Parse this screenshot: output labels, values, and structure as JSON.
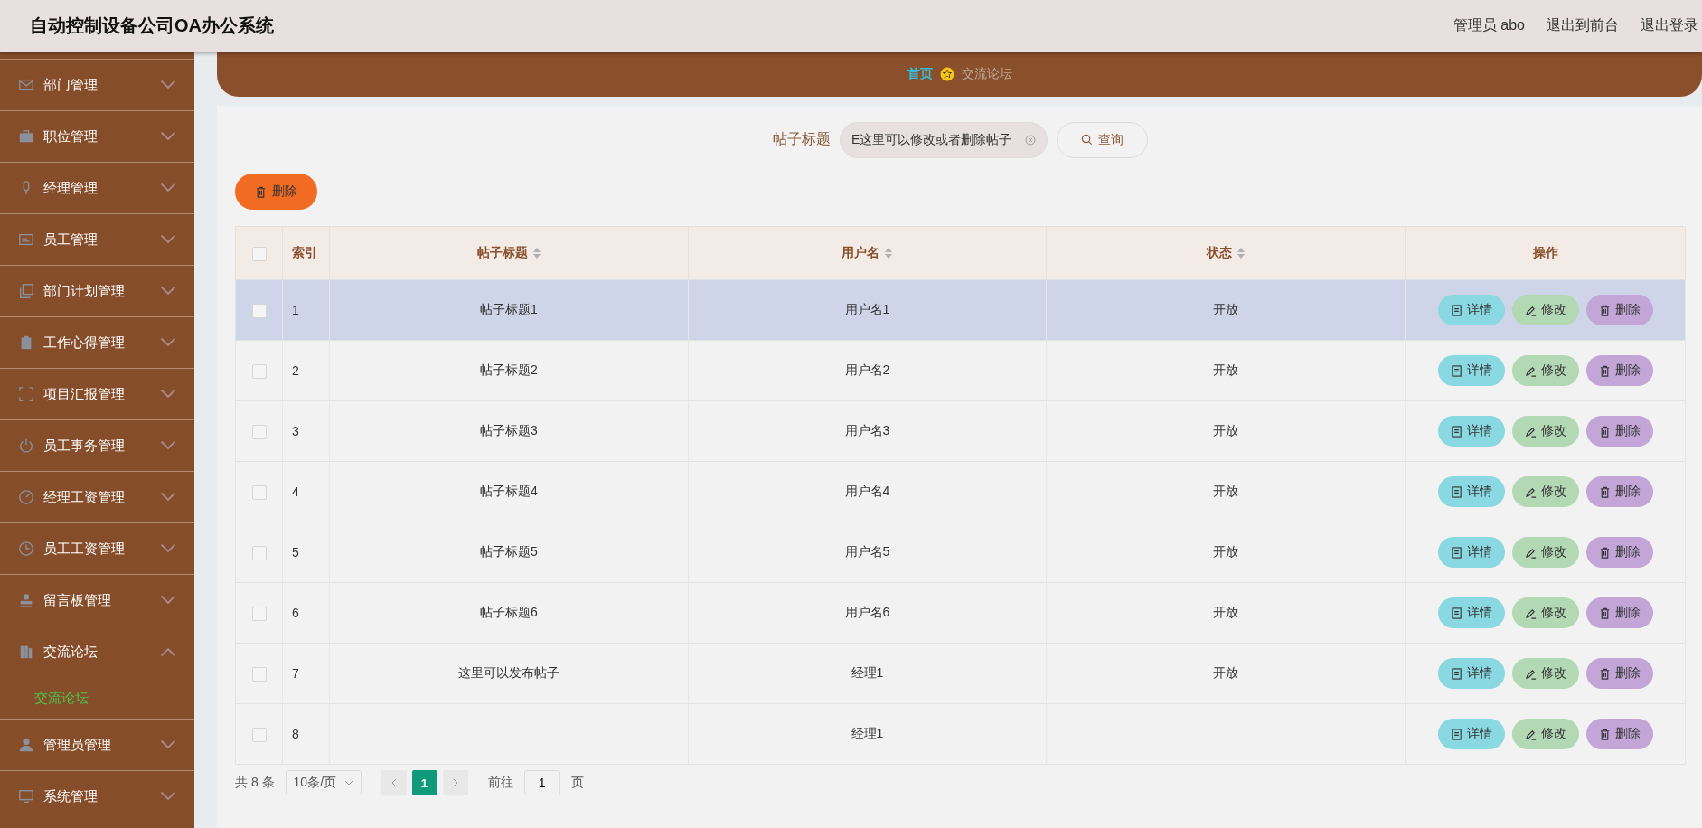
{
  "header": {
    "title": "自动控制设备公司OA办公系统",
    "links": [
      "管理员 abo",
      "退出到前台",
      "退出登录"
    ]
  },
  "sidebar": {
    "items": [
      {
        "label": "部门管理",
        "expanded": false
      },
      {
        "label": "职位管理",
        "expanded": false
      },
      {
        "label": "经理管理",
        "expanded": false
      },
      {
        "label": "员工管理",
        "expanded": false
      },
      {
        "label": "部门计划管理",
        "expanded": false
      },
      {
        "label": "工作心得管理",
        "expanded": false
      },
      {
        "label": "项目汇报管理",
        "expanded": false
      },
      {
        "label": "员工事务管理",
        "expanded": false
      },
      {
        "label": "经理工资管理",
        "expanded": false
      },
      {
        "label": "员工工资管理",
        "expanded": false
      },
      {
        "label": "留言板管理",
        "expanded": false
      },
      {
        "label": "交流论坛",
        "expanded": true,
        "children": [
          {
            "label": "交流论坛",
            "selected": true
          }
        ]
      },
      {
        "label": "管理员管理",
        "expanded": false
      },
      {
        "label": "系统管理",
        "expanded": false
      }
    ]
  },
  "breadcrumb": [
    "首页",
    "交流论坛"
  ],
  "search": {
    "label": "帖子标题",
    "value": "E这里可以修改或者删除帖子",
    "button": "查询"
  },
  "delete_button": "删除",
  "table": {
    "select_all": false,
    "columns": [
      "索引",
      "帖子标题",
      "用户名",
      "状态",
      "操作"
    ],
    "rows": [
      {
        "checked": false,
        "highlighted": true,
        "cells": [
          "1",
          "帖子标题1",
          "用户名1",
          "开放"
        ],
        "actions": [
          "详情",
          "修改",
          "删除"
        ]
      },
      {
        "checked": false,
        "highlighted": false,
        "cells": [
          "2",
          "帖子标题2",
          "用户名2",
          "开放"
        ],
        "actions": [
          "详情",
          "修改",
          "删除"
        ]
      },
      {
        "checked": false,
        "highlighted": false,
        "cells": [
          "3",
          "帖子标题3",
          "用户名3",
          "开放"
        ],
        "actions": [
          "详情",
          "修改",
          "删除"
        ]
      },
      {
        "checked": false,
        "highlighted": false,
        "cells": [
          "4",
          "帖子标题4",
          "用户名4",
          "开放"
        ],
        "actions": [
          "详情",
          "修改",
          "删除"
        ]
      },
      {
        "checked": false,
        "highlighted": false,
        "cells": [
          "5",
          "帖子标题5",
          "用户名5",
          "开放"
        ],
        "actions": [
          "详情",
          "修改",
          "删除"
        ]
      },
      {
        "checked": false,
        "highlighted": false,
        "cells": [
          "6",
          "帖子标题6",
          "用户名6",
          "开放"
        ],
        "actions": [
          "详情",
          "修改",
          "删除"
        ]
      },
      {
        "checked": false,
        "highlighted": false,
        "cells": [
          "7",
          "这里可以发布帖子",
          "经理1",
          "开放"
        ],
        "actions": [
          "详情",
          "修改",
          "删除"
        ]
      },
      {
        "checked": false,
        "highlighted": false,
        "cells": [
          "8",
          "",
          "经理1",
          ""
        ],
        "actions": [
          "详情",
          "修改",
          "删除"
        ]
      }
    ]
  },
  "pagination": {
    "total": "共 8 条",
    "page_size": "10条/页",
    "pages": [
      {
        "label": "1",
        "selected": true
      }
    ],
    "goto_label": "前往",
    "goto_value": "1",
    "goto_suffix": "页"
  }
}
